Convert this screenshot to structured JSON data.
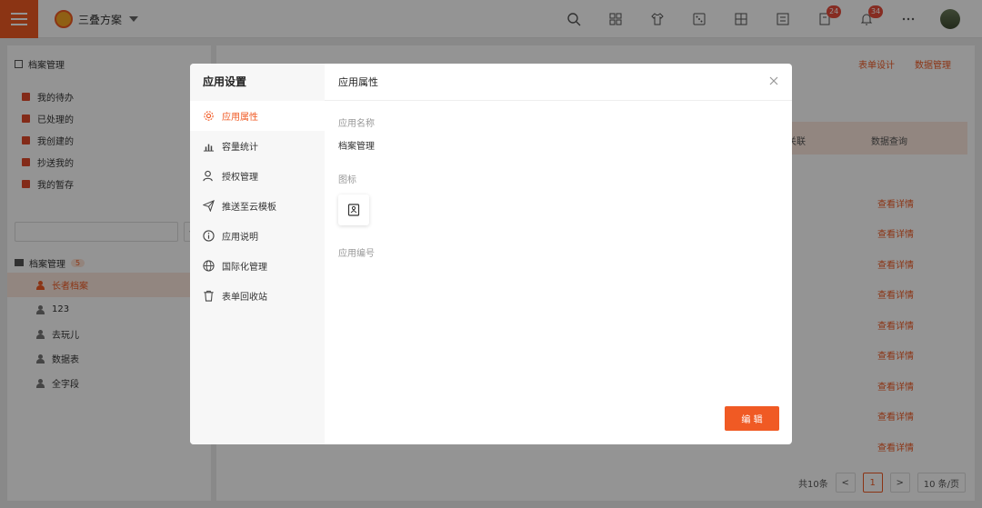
{
  "topbar": {
    "app_name": "三叠方案",
    "badges": {
      "notification_a": "24",
      "notification_b": "34"
    }
  },
  "sidebar": {
    "title": "档案管理",
    "shortcuts": [
      {
        "label": "我的待办"
      },
      {
        "label": "已处理的"
      },
      {
        "label": "我创建的"
      },
      {
        "label": "抄送我的"
      },
      {
        "label": "我的暂存"
      }
    ],
    "tree": {
      "root_label": "档案管理",
      "root_count": "5",
      "nodes": [
        {
          "label": "长者档案"
        },
        {
          "label": "123"
        },
        {
          "label": "去玩儿"
        },
        {
          "label": "数据表"
        },
        {
          "label": "全字段"
        }
      ]
    }
  },
  "main": {
    "actions": {
      "form_design": "表单设计",
      "data_manage": "数据管理"
    },
    "table": {
      "col_related": "关联",
      "col_query": "数据查询",
      "row_link": "查看详情"
    },
    "pager": {
      "total": "共10条",
      "page": "1",
      "size": "10 条/页"
    }
  },
  "modal": {
    "title": "应用设置",
    "section_title": "应用属性",
    "nav": [
      {
        "label": "应用属性"
      },
      {
        "label": "容量统计"
      },
      {
        "label": "授权管理"
      },
      {
        "label": "推送至云模板"
      },
      {
        "label": "应用说明"
      },
      {
        "label": "国际化管理"
      },
      {
        "label": "表单回收站"
      }
    ],
    "fields": {
      "name_label": "应用名称",
      "name_value": "档案管理",
      "icon_label": "图标",
      "code_label": "应用编号"
    },
    "edit_button": "编 辑"
  },
  "colors": {
    "accent": "#f05a24",
    "accent_light": "#fbe7dd"
  }
}
